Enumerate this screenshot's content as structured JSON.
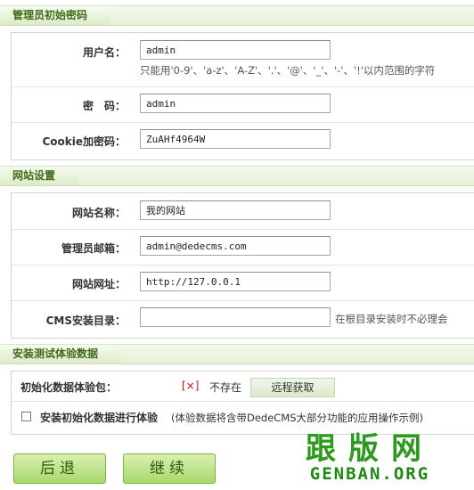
{
  "sections": {
    "admin_title": "管理员初始密码",
    "site_title": "网站设置",
    "demo_title": "安装测试体验数据"
  },
  "admin": {
    "username_label": "用户名：",
    "username_value": "admin",
    "username_hint": "只能用'0-9'、'a-z'、'A-Z'、'.'、'@'、'_'、'-'、'!'以内范围的字符",
    "password_label": "密　码：",
    "password_value": "admin",
    "cookie_label": "Cookie加密码：",
    "cookie_value": "ZuAHf4964W"
  },
  "site": {
    "name_label": "网站名称：",
    "name_value": "我的网站",
    "email_label": "管理员邮箱：",
    "email_value": "admin@dedecms.com",
    "url_label": "网站网址：",
    "url_value": "http://127.0.0.1",
    "dir_label": "CMS安装目录：",
    "dir_value": "",
    "dir_hint": "在根目录安装时不必理会"
  },
  "demo": {
    "package_label": "初始化数据体验包：",
    "status_mark": "[×]",
    "status_text": "不存在",
    "fetch_button": "远程获取",
    "install_label": "安装初始化数据进行体验",
    "install_note": "(体验数据将含带DedeCMS大部分功能的应用操作示例)"
  },
  "footer": {
    "back_button": "后退",
    "continue_button": "继续"
  },
  "logo": {
    "cn": "跟版网",
    "en": "GENBAN.ORG"
  }
}
